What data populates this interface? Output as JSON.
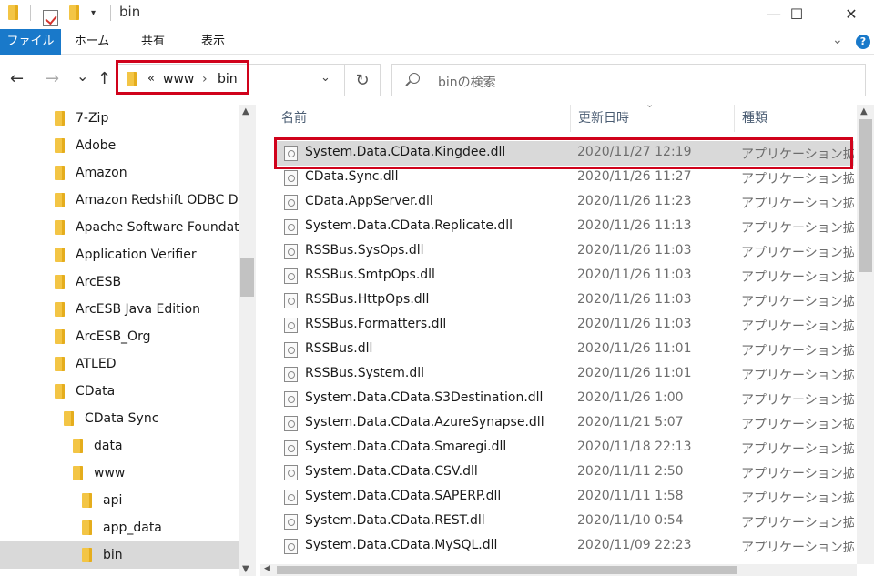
{
  "window": {
    "title": "bin",
    "controls": {
      "minimize": "—",
      "maximize": "☐",
      "close": "✕"
    }
  },
  "ribbon": {
    "tabs": [
      "ファイル",
      "ホーム",
      "共有",
      "表示"
    ],
    "collapse_icon": "chevron-down-icon",
    "help_label": "?",
    "accent_color": "#1979ca"
  },
  "address": {
    "back": "←",
    "forward": "→",
    "recent": "⌄",
    "up": "↑",
    "overflow": "«",
    "crumbs": [
      "www",
      "bin"
    ],
    "separator": "›",
    "dropdown": "⌄",
    "refresh": "↻"
  },
  "search": {
    "placeholder": "binの検索"
  },
  "nav_pane": {
    "items": [
      {
        "label": "7-Zip",
        "indent": 0
      },
      {
        "label": "Adobe",
        "indent": 0
      },
      {
        "label": "Amazon",
        "indent": 0
      },
      {
        "label": "Amazon Redshift ODBC Driver",
        "indent": 0
      },
      {
        "label": "Apache Software Foundation",
        "indent": 0
      },
      {
        "label": "Application Verifier",
        "indent": 0
      },
      {
        "label": "ArcESB",
        "indent": 0
      },
      {
        "label": "ArcESB Java Edition",
        "indent": 0
      },
      {
        "label": "ArcESB_Org",
        "indent": 0
      },
      {
        "label": "ATLED",
        "indent": 0
      },
      {
        "label": "CData",
        "indent": 0
      },
      {
        "label": "CData Sync",
        "indent": 1
      },
      {
        "label": "data",
        "indent": 2
      },
      {
        "label": "www",
        "indent": 2
      },
      {
        "label": "api",
        "indent": 3
      },
      {
        "label": "app_data",
        "indent": 3
      },
      {
        "label": "bin",
        "indent": 3,
        "selected": true
      }
    ]
  },
  "file_list": {
    "columns": {
      "name": "名前",
      "date": "更新日時",
      "type": "種類"
    },
    "files": [
      {
        "name": "System.Data.CData.Kingdee.dll",
        "date": "2020/11/27 12:19",
        "type": "アプリケーション拡張",
        "selected": true
      },
      {
        "name": "CData.Sync.dll",
        "date": "2020/11/26 11:27",
        "type": "アプリケーション拡張"
      },
      {
        "name": "CData.AppServer.dll",
        "date": "2020/11/26 11:23",
        "type": "アプリケーション拡張"
      },
      {
        "name": "System.Data.CData.Replicate.dll",
        "date": "2020/11/26 11:13",
        "type": "アプリケーション拡張"
      },
      {
        "name": "RSSBus.SysOps.dll",
        "date": "2020/11/26 11:03",
        "type": "アプリケーション拡張"
      },
      {
        "name": "RSSBus.SmtpOps.dll",
        "date": "2020/11/26 11:03",
        "type": "アプリケーション拡張"
      },
      {
        "name": "RSSBus.HttpOps.dll",
        "date": "2020/11/26 11:03",
        "type": "アプリケーション拡張"
      },
      {
        "name": "RSSBus.Formatters.dll",
        "date": "2020/11/26 11:03",
        "type": "アプリケーション拡張"
      },
      {
        "name": "RSSBus.dll",
        "date": "2020/11/26 11:01",
        "type": "アプリケーション拡張"
      },
      {
        "name": "RSSBus.System.dll",
        "date": "2020/11/26 11:01",
        "type": "アプリケーション拡張"
      },
      {
        "name": "System.Data.CData.S3Destination.dll",
        "date": "2020/11/26 1:00",
        "type": "アプリケーション拡張"
      },
      {
        "name": "System.Data.CData.AzureSynapse.dll",
        "date": "2020/11/21 5:07",
        "type": "アプリケーション拡張"
      },
      {
        "name": "System.Data.CData.Smaregi.dll",
        "date": "2020/11/18 22:13",
        "type": "アプリケーション拡張"
      },
      {
        "name": "System.Data.CData.CSV.dll",
        "date": "2020/11/11 2:50",
        "type": "アプリケーション拡張"
      },
      {
        "name": "System.Data.CData.SAPERP.dll",
        "date": "2020/11/11 1:58",
        "type": "アプリケーション拡張"
      },
      {
        "name": "System.Data.CData.REST.dll",
        "date": "2020/11/10 0:54",
        "type": "アプリケーション拡張"
      },
      {
        "name": "System.Data.CData.MySQL.dll",
        "date": "2020/11/09 22:23",
        "type": "アプリケーション拡張"
      }
    ]
  },
  "highlight_color": "#d0021b"
}
